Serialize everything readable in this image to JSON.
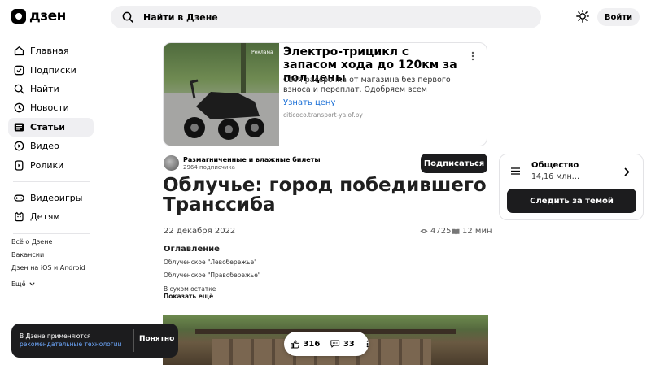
{
  "header": {
    "logo_text": "дзен",
    "search_placeholder": "Найти в Дзене",
    "login_label": "Войти"
  },
  "sidebar": {
    "items": [
      {
        "label": "Главная",
        "icon": "home-icon"
      },
      {
        "label": "Подписки",
        "icon": "subscriptions-icon"
      },
      {
        "label": "Найти",
        "icon": "search-icon"
      },
      {
        "label": "Новости",
        "icon": "news-icon"
      },
      {
        "label": "Статьи",
        "icon": "articles-icon",
        "active": true
      },
      {
        "label": "Видео",
        "icon": "video-icon"
      },
      {
        "label": "Ролики",
        "icon": "shorts-icon"
      },
      {
        "label": "Видеоигры",
        "icon": "gamepad-icon"
      },
      {
        "label": "Детям",
        "icon": "kids-icon"
      }
    ],
    "footer_links": [
      "Всё о Дзене",
      "Вакансии",
      "Дзен на iOS и Android",
      "Ещё"
    ]
  },
  "ad": {
    "tag": "Реклама",
    "title": "Электро-трицикл с запасом хода до 120км за пол цены",
    "description": "Своя рассрочка от магазина без первого взноса и переплат. Одобряем всем",
    "link": "Узнать цену",
    "domain": "citicoco.transport-ya.of.by"
  },
  "channel": {
    "name": "Размагниченные и влажные билеты",
    "subscribers": "2964 подписчика",
    "subscribe_label": "Подписаться"
  },
  "article": {
    "title": "Облучье: город победившего Транссиба",
    "date": "22 декабря 2022",
    "views": "4725",
    "read_time": "12 мин",
    "toc_title": "Оглавление",
    "toc_items": [
      "Облученское \"Левобережье\"",
      "Облученское \"Правобережье\"",
      "В сухом остатке"
    ],
    "toc_more": "Показать ещё"
  },
  "reactions": {
    "likes": "316",
    "comments": "33"
  },
  "topic_widget": {
    "title": "Общество",
    "count": "14,16 млн…",
    "follow_label": "Следить за темой"
  },
  "cookie_toast": {
    "text": "В Дзене применяются",
    "link": "рекомендательные технологии",
    "button": "Понятно"
  },
  "colors": {
    "accent_link": "#1a6fd6",
    "dark_button": "#1c1c1e",
    "active_nav_bg": "#efeff2"
  }
}
